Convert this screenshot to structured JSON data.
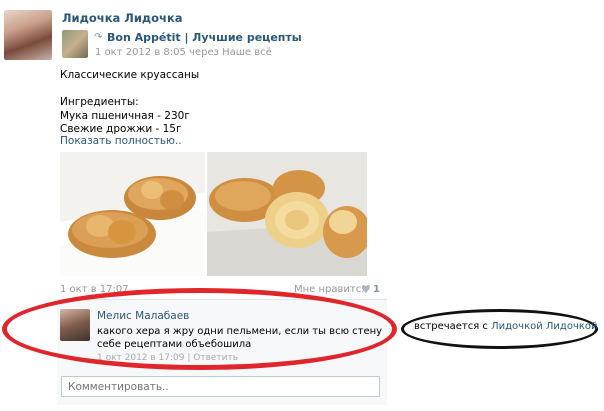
{
  "post": {
    "author": "Лидочка Лидочка",
    "repost": {
      "group_name": "Bon Appétit | Лучшие рецепты",
      "meta": "1 окт 2012 в 8:05 через Наше всё"
    },
    "text_lines": [
      "Классические круассаны",
      "",
      "Ингредиенты:",
      "Мука пшеничная - 230г",
      "Свежие дрожжи - 15г"
    ],
    "show_more": "Показать полностью..",
    "time": "1 окт в 17:07",
    "like_label": "Мне нравится",
    "like_count": "1"
  },
  "comment": {
    "author": "Мелис Малабаев",
    "text": "какого хера я жру одни пельмени, если ты всю стену себе рецептами объебошила",
    "footer": "1 окт 2012 в 17:09 | Ответить"
  },
  "comment_input": {
    "placeholder": "Комментировать.."
  },
  "relationship": {
    "prefix": "встречается с ",
    "partner": "Лидочкой Лидочкой"
  },
  "icons": {
    "repost": "repost-arrow-icon",
    "like": "heart-icon"
  },
  "colors": {
    "link": "#2b587a",
    "muted": "#999999",
    "red_marker": "#e0262b",
    "black_marker": "#111111"
  }
}
